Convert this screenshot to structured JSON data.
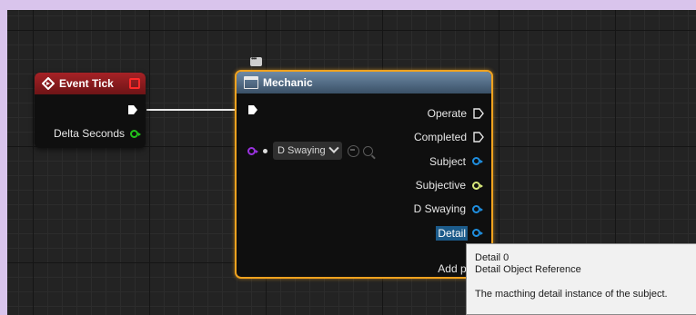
{
  "event_node": {
    "title": "Event Tick",
    "delta_label": "Delta Seconds",
    "pin_color": "#22c31b"
  },
  "function_node": {
    "title": "Mechanic",
    "dropdown_value": "D Swaying",
    "outputs": [
      {
        "label": "Operate",
        "kind": "exec"
      },
      {
        "label": "Completed",
        "kind": "exec"
      },
      {
        "label": "Subject",
        "kind": "object",
        "color": "#1f8fe0"
      },
      {
        "label": "Subjective",
        "kind": "object",
        "color": "#d8e87a"
      },
      {
        "label": "D Swaying",
        "kind": "object",
        "color": "#1f8fe0"
      },
      {
        "label": "Detail",
        "kind": "object",
        "color": "#1f8fe0",
        "highlighted": true
      }
    ],
    "add_pin_label": "Add pin",
    "input_pin_color": "#9a32e0"
  },
  "tooltip": {
    "line1": "Detail 0",
    "line2": "Detail Object Reference",
    "line3": "The macthing detail instance of the subject."
  }
}
